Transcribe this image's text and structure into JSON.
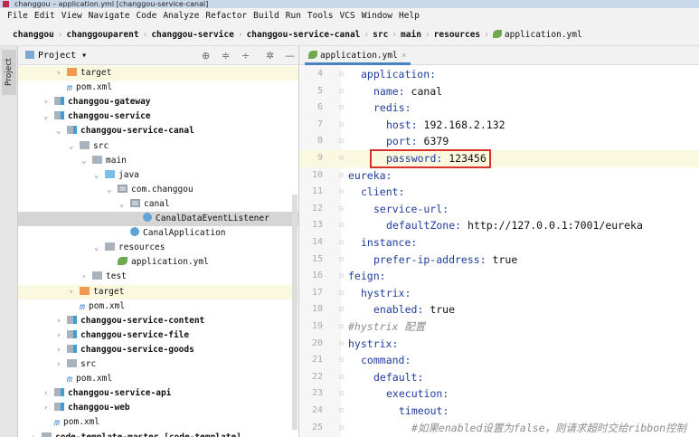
{
  "window": {
    "title": "changgou – application.yml [changgou-service-canal]"
  },
  "menu": [
    "File",
    "Edit",
    "View",
    "Navigate",
    "Code",
    "Analyze",
    "Refactor",
    "Build",
    "Run",
    "Tools",
    "VCS",
    "Window",
    "Help"
  ],
  "breadcrumbs": [
    "changgou",
    "changgouparent",
    "changgou-service",
    "changgou-service-canal",
    "src",
    "main",
    "resources",
    "application.yml"
  ],
  "project_panel": {
    "title": "Project",
    "strip_label": "Project"
  },
  "tree": [
    {
      "label": "target",
      "icon": "folder-orange",
      "depth": 4,
      "arrow": "›",
      "hl": true
    },
    {
      "label": "pom.xml",
      "icon": "maven",
      "depth": 4,
      "arrow": ""
    },
    {
      "label": "changgou-gateway",
      "icon": "module",
      "depth": 3,
      "arrow": "›",
      "bold": true
    },
    {
      "label": "changgou-service",
      "icon": "module",
      "depth": 3,
      "arrow": "⌄",
      "bold": true
    },
    {
      "label": "changgou-service-canal",
      "icon": "module",
      "depth": 4,
      "arrow": "⌄",
      "bold": true
    },
    {
      "label": "src",
      "icon": "folder",
      "depth": 5,
      "arrow": "⌄"
    },
    {
      "label": "main",
      "icon": "folder",
      "depth": 6,
      "arrow": "⌄"
    },
    {
      "label": "java",
      "icon": "folder-blue",
      "depth": 7,
      "arrow": "⌄"
    },
    {
      "label": "com.changgou",
      "icon": "package",
      "depth": 8,
      "arrow": "⌄"
    },
    {
      "label": "canal",
      "icon": "package",
      "depth": 9,
      "arrow": "⌄"
    },
    {
      "label": "CanalDataEventListener",
      "icon": "class",
      "depth": 10,
      "arrow": "",
      "sel": true
    },
    {
      "label": "CanalApplication",
      "icon": "spring-class",
      "depth": 9,
      "arrow": ""
    },
    {
      "label": "resources",
      "icon": "folder",
      "depth": 7,
      "arrow": "⌄"
    },
    {
      "label": "application.yml",
      "icon": "yml",
      "depth": 8,
      "arrow": ""
    },
    {
      "label": "test",
      "icon": "folder",
      "depth": 6,
      "arrow": "›"
    },
    {
      "label": "target",
      "icon": "folder-orange",
      "depth": 5,
      "arrow": "›",
      "hl": true
    },
    {
      "label": "pom.xml",
      "icon": "maven",
      "depth": 5,
      "arrow": ""
    },
    {
      "label": "changgou-service-content",
      "icon": "module",
      "depth": 4,
      "arrow": "›",
      "bold": true
    },
    {
      "label": "changgou-service-file",
      "icon": "module",
      "depth": 4,
      "arrow": "›",
      "bold": true
    },
    {
      "label": "changgou-service-goods",
      "icon": "module",
      "depth": 4,
      "arrow": "›",
      "bold": true
    },
    {
      "label": "src",
      "icon": "folder",
      "depth": 4,
      "arrow": "›"
    },
    {
      "label": "pom.xml",
      "icon": "maven",
      "depth": 4,
      "arrow": ""
    },
    {
      "label": "changgou-service-api",
      "icon": "module",
      "depth": 3,
      "arrow": "›",
      "bold": true
    },
    {
      "label": "changgou-web",
      "icon": "module",
      "depth": 3,
      "arrow": "›",
      "bold": true
    },
    {
      "label": "pom.xml",
      "icon": "maven",
      "depth": 3,
      "arrow": ""
    },
    {
      "label": "code-template-master [code-template]",
      "icon": "folder",
      "depth": 2,
      "arrow": "›",
      "bold": true
    }
  ],
  "editor": {
    "tab": "application.yml",
    "lines": [
      {
        "n": "4",
        "indent": 1,
        "key": "application:",
        "val": ""
      },
      {
        "n": "5",
        "indent": 2,
        "key": "name:",
        "val": " canal"
      },
      {
        "n": "6",
        "indent": 2,
        "key": "redis:",
        "val": ""
      },
      {
        "n": "7",
        "indent": 3,
        "key": "host:",
        "val": " 192.168.2.132"
      },
      {
        "n": "8",
        "indent": 3,
        "key": "port:",
        "val": " 6379"
      },
      {
        "n": "9",
        "indent": 3,
        "key": "password:",
        "val": " 123456",
        "cur": true
      },
      {
        "n": "10",
        "indent": 0,
        "key": "eureka:",
        "val": ""
      },
      {
        "n": "11",
        "indent": 1,
        "key": "client:",
        "val": ""
      },
      {
        "n": "12",
        "indent": 2,
        "key": "service-url:",
        "val": ""
      },
      {
        "n": "13",
        "indent": 3,
        "key": "defaultZone:",
        "val": " http://127.0.0.1:7001/eureka"
      },
      {
        "n": "14",
        "indent": 1,
        "key": "instance:",
        "val": ""
      },
      {
        "n": "15",
        "indent": 2,
        "key": "prefer-ip-address:",
        "val": " true"
      },
      {
        "n": "16",
        "indent": 0,
        "key": "feign:",
        "val": ""
      },
      {
        "n": "17",
        "indent": 1,
        "key": "hystrix:",
        "val": ""
      },
      {
        "n": "18",
        "indent": 2,
        "key": "enabled:",
        "val": " true"
      },
      {
        "n": "19",
        "indent": 0,
        "comment": "#hystrix 配置"
      },
      {
        "n": "20",
        "indent": 0,
        "key": "hystrix:",
        "val": ""
      },
      {
        "n": "21",
        "indent": 1,
        "key": "command:",
        "val": ""
      },
      {
        "n": "22",
        "indent": 2,
        "key": "default:",
        "val": ""
      },
      {
        "n": "23",
        "indent": 3,
        "key": "execution:",
        "val": ""
      },
      {
        "n": "24",
        "indent": 4,
        "key": "timeout:",
        "val": ""
      },
      {
        "n": "25",
        "indent": 5,
        "comment": "#如果enabled设置为false，则请求超时交给ribbon控制"
      }
    ]
  },
  "colors": {
    "highlight_box": "#d9322b",
    "key": "#1f3e9e",
    "tab_underline": "#4a83c4"
  }
}
